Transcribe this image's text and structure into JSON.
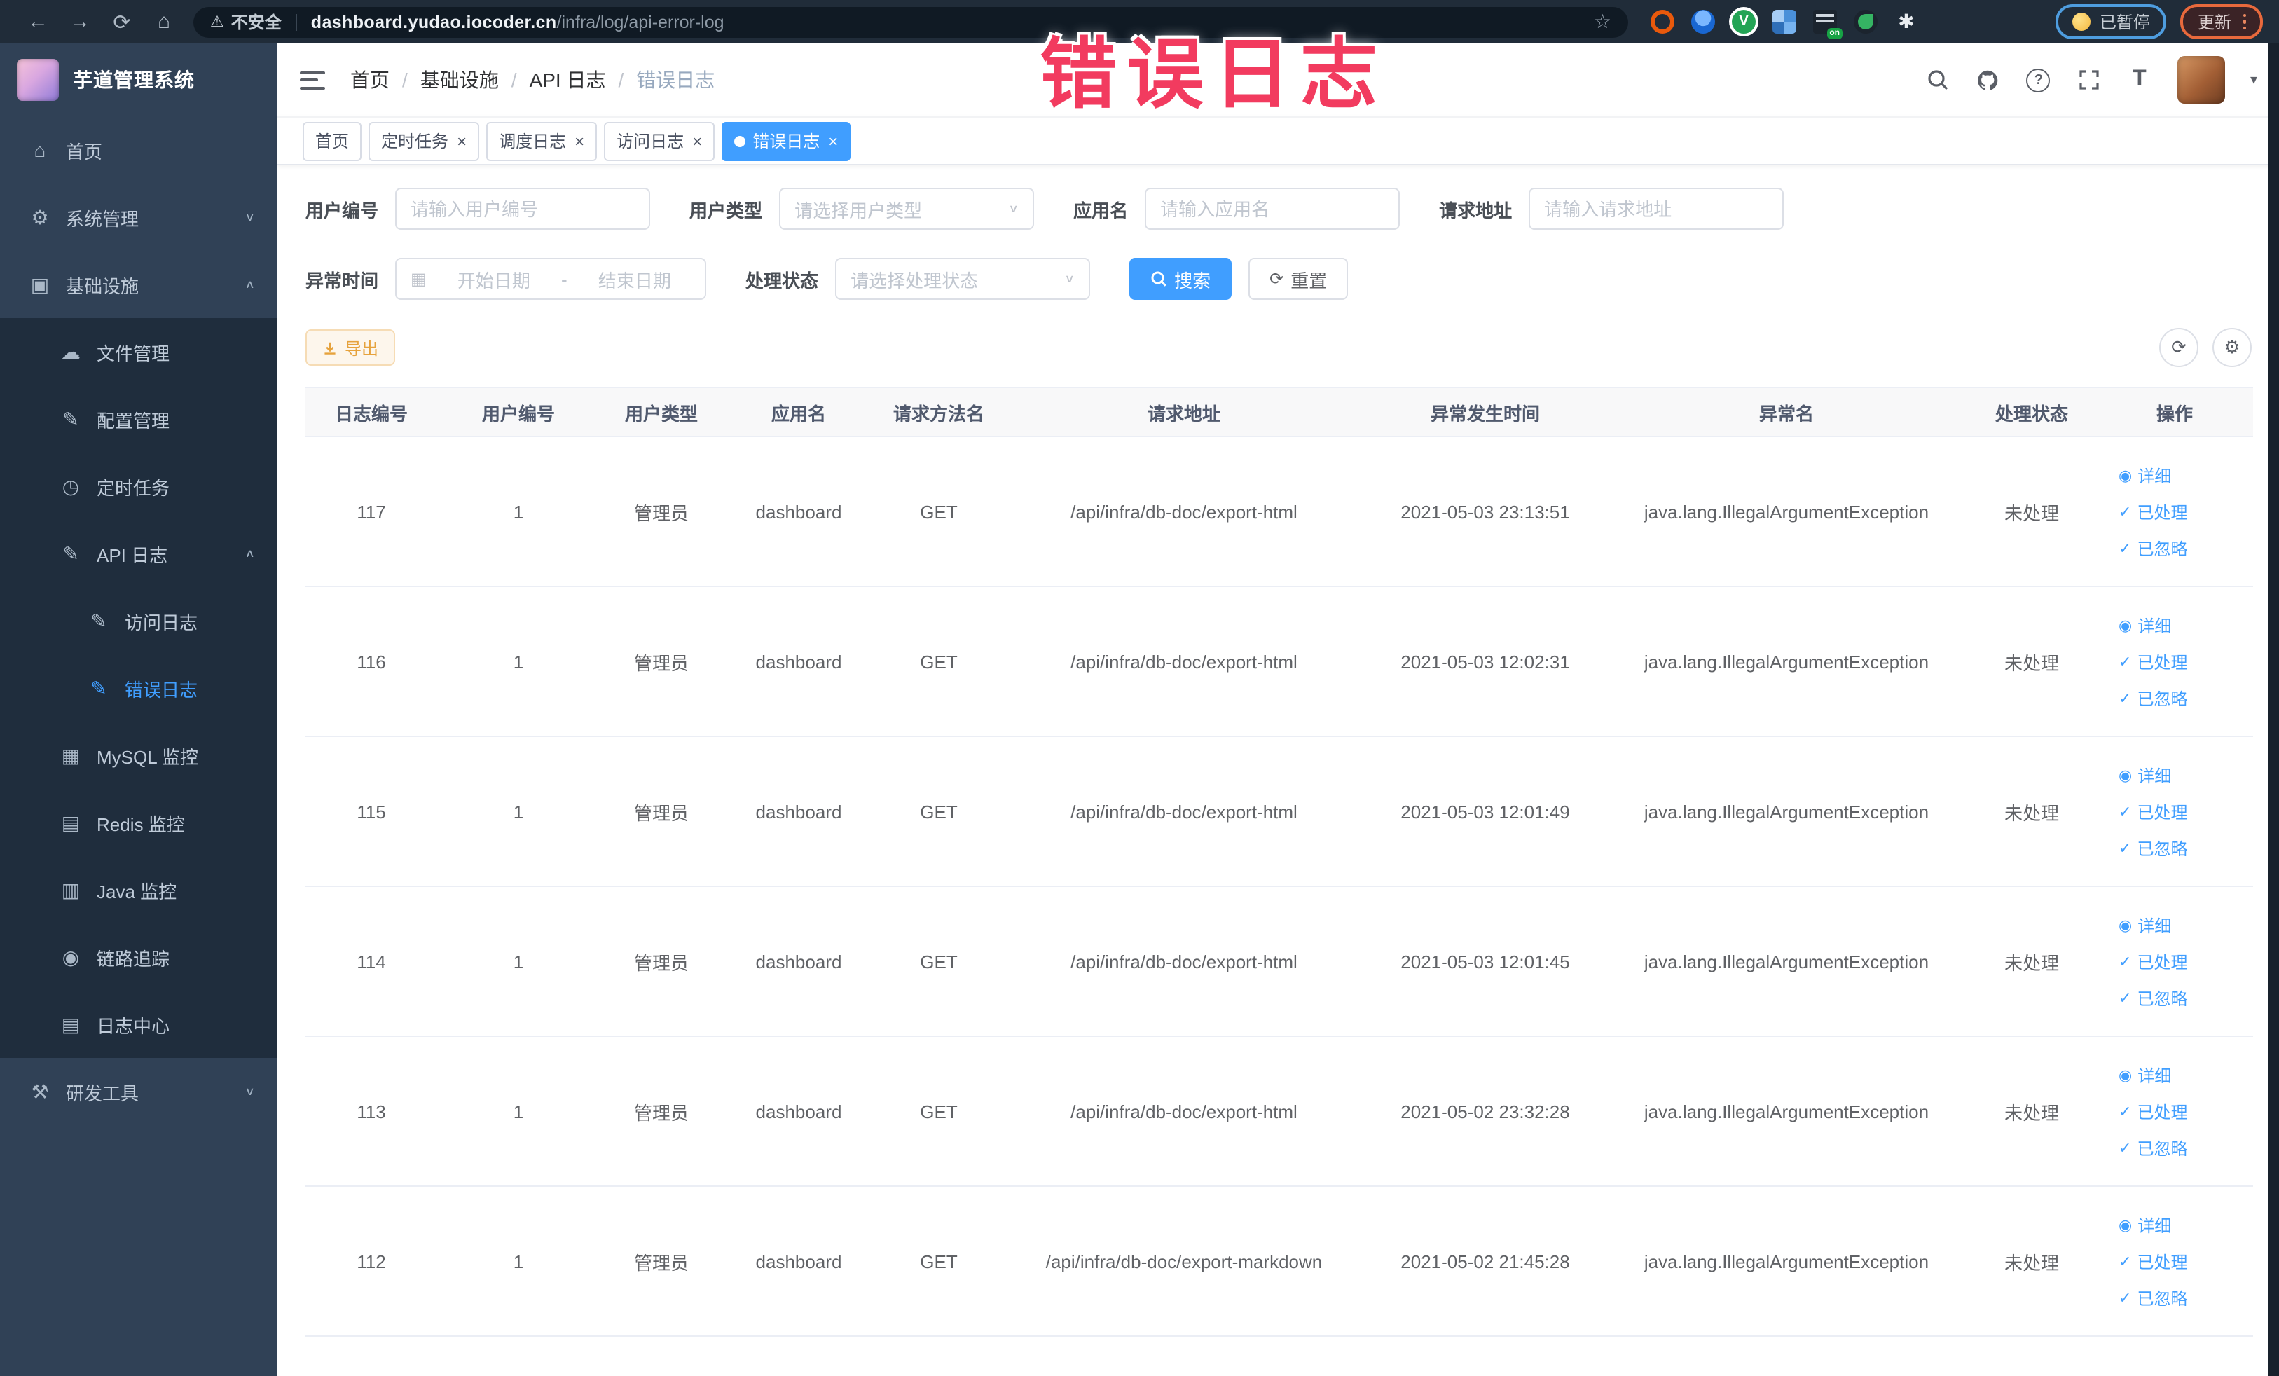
{
  "annotation": {
    "text": "错误日志",
    "color": "#f23b5f"
  },
  "browser": {
    "security_label": "不安全",
    "url_host": "dashboard.yudao.iocoder.cn",
    "url_path": "/infra/log/api-error-log",
    "paused_badge": "已暂停",
    "update_button": "更新",
    "ext_on_label": "on",
    "icons": {
      "back": "←",
      "forward": "→",
      "reload": "⟳",
      "home": "⌂",
      "warning": "⚠",
      "star": "☆",
      "ext_v": "V",
      "ext_puzzle": "✱"
    }
  },
  "sidebar": {
    "title": "芋道管理系统",
    "items": [
      {
        "name": "home",
        "glyph": "⌂",
        "label": "首页",
        "classes": "lvl0",
        "arrow": ""
      },
      {
        "name": "system-management",
        "glyph": "⚙",
        "label": "系统管理",
        "classes": "lvl0",
        "arrow": "∨"
      },
      {
        "name": "infrastructure",
        "glyph": "▣",
        "label": "基础设施",
        "classes": "lvl0",
        "arrow": "∧"
      },
      {
        "name": "file-management",
        "glyph": "☁",
        "label": "文件管理",
        "classes": "lvl1 sub",
        "arrow": ""
      },
      {
        "name": "config-management",
        "glyph": "✎",
        "label": "配置管理",
        "classes": "lvl1 sub",
        "arrow": ""
      },
      {
        "name": "scheduled-tasks",
        "glyph": "◷",
        "label": "定时任务",
        "classes": "lvl1 sub",
        "arrow": ""
      },
      {
        "name": "api-log",
        "glyph": "✎",
        "label": "API 日志",
        "classes": "lvl1 sub",
        "arrow": "∧"
      },
      {
        "name": "access-log",
        "glyph": "✎",
        "label": "访问日志",
        "classes": "lvl2 sub",
        "arrow": ""
      },
      {
        "name": "error-log",
        "glyph": "✎",
        "label": "错误日志",
        "classes": "lvl2 sub active",
        "arrow": ""
      },
      {
        "name": "mysql-monitor",
        "glyph": "▦",
        "label": "MySQL 监控",
        "classes": "lvl1 sub",
        "arrow": ""
      },
      {
        "name": "redis-monitor",
        "glyph": "▤",
        "label": "Redis 监控",
        "classes": "lvl1 sub",
        "arrow": ""
      },
      {
        "name": "java-monitor",
        "glyph": "▥",
        "label": "Java 监控",
        "classes": "lvl1 sub",
        "arrow": ""
      },
      {
        "name": "trace",
        "glyph": "◉",
        "label": "链路追踪",
        "classes": "lvl1 sub",
        "arrow": ""
      },
      {
        "name": "log-center",
        "glyph": "▤",
        "label": "日志中心",
        "classes": "lvl1 sub",
        "arrow": ""
      },
      {
        "name": "dev-tools",
        "glyph": "⚒",
        "label": "研发工具",
        "classes": "lvl0",
        "arrow": "∨"
      }
    ]
  },
  "navbar": {
    "breadcrumb": [
      {
        "label": "首页",
        "classes": ""
      },
      {
        "label": "基础设施",
        "classes": ""
      },
      {
        "label": "API 日志",
        "classes": ""
      },
      {
        "label": "错误日志",
        "classes": "last"
      }
    ],
    "icons": {
      "help": "?",
      "fontsize": "T",
      "caret": "▾"
    }
  },
  "tabs": [
    {
      "label": "首页",
      "classes": ""
    },
    {
      "label": "定时任务",
      "classes": "closable"
    },
    {
      "label": "调度日志",
      "classes": "closable"
    },
    {
      "label": "访问日志",
      "classes": "closable"
    },
    {
      "label": "错误日志",
      "classes": "active closable"
    }
  ],
  "filters": {
    "user_id_label": "用户编号",
    "user_id_placeholder": "请输入用户编号",
    "user_type_label": "用户类型",
    "user_type_placeholder": "请选择用户类型",
    "app_label": "应用名",
    "app_placeholder": "请输入应用名",
    "url_label": "请求地址",
    "url_placeholder": "请输入请求地址",
    "time_label": "异常时间",
    "time_start_placeholder": "开始日期",
    "time_separator": "-",
    "time_end_placeholder": "结束日期",
    "status_label": "处理状态",
    "status_placeholder": "请选择处理状态",
    "search_label": "搜索",
    "reset_label": "重置"
  },
  "toolbar": {
    "export_label": "导出"
  },
  "table": {
    "headers": [
      "日志编号",
      "用户编号",
      "用户类型",
      "应用名",
      "请求方法名",
      "请求地址",
      "异常发生时间",
      "异常名",
      "处理状态",
      "操作"
    ],
    "actions": [
      {
        "glyph": "◉",
        "label": "详细"
      },
      {
        "glyph": "✓",
        "label": "已处理"
      },
      {
        "glyph": "✓",
        "label": "已忽略"
      }
    ],
    "rows": [
      {
        "id": "117",
        "user_id": "1",
        "user_type": "管理员",
        "app": "dashboard",
        "method": "GET",
        "url": "/api/infra/db-doc/export-html",
        "time": "2021-05-03 23:13:51",
        "exception": "java.lang.IllegalArgumentException",
        "status": "未处理"
      },
      {
        "id": "116",
        "user_id": "1",
        "user_type": "管理员",
        "app": "dashboard",
        "method": "GET",
        "url": "/api/infra/db-doc/export-html",
        "time": "2021-05-03 12:02:31",
        "exception": "java.lang.IllegalArgumentException",
        "status": "未处理"
      },
      {
        "id": "115",
        "user_id": "1",
        "user_type": "管理员",
        "app": "dashboard",
        "method": "GET",
        "url": "/api/infra/db-doc/export-html",
        "time": "2021-05-03 12:01:49",
        "exception": "java.lang.IllegalArgumentException",
        "status": "未处理"
      },
      {
        "id": "114",
        "user_id": "1",
        "user_type": "管理员",
        "app": "dashboard",
        "method": "GET",
        "url": "/api/infra/db-doc/export-html",
        "time": "2021-05-03 12:01:45",
        "exception": "java.lang.IllegalArgumentException",
        "status": "未处理"
      },
      {
        "id": "113",
        "user_id": "1",
        "user_type": "管理员",
        "app": "dashboard",
        "method": "GET",
        "url": "/api/infra/db-doc/export-html",
        "time": "2021-05-02 23:32:28",
        "exception": "java.lang.IllegalArgumentException",
        "status": "未处理"
      },
      {
        "id": "112",
        "user_id": "1",
        "user_type": "管理员",
        "app": "dashboard",
        "method": "GET",
        "url": "/api/infra/db-doc/export-markdown",
        "time": "2021-05-02 21:45:28",
        "exception": "java.lang.IllegalArgumentException",
        "status": "未处理"
      }
    ]
  },
  "colors": {
    "accent": "#409eff",
    "sidebar_bg": "#304156",
    "submenu_bg": "#1f2d3d",
    "browser_bar": "#202c39",
    "warning_button": "#e6a23c",
    "annotation": "#f23b5f"
  }
}
